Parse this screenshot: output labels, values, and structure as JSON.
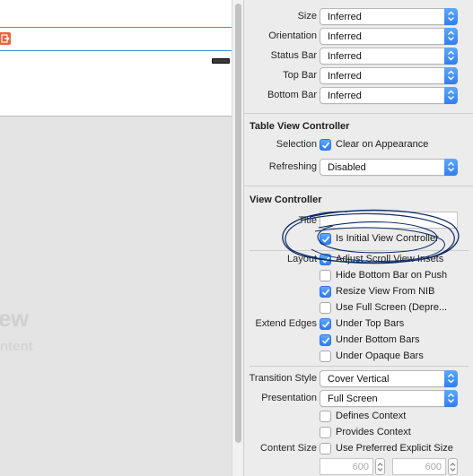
{
  "canvas": {
    "ghost_title": "ew",
    "ghost_subtitle": "ntent"
  },
  "simulated_metrics": [
    {
      "label": "Size",
      "value": "Inferred"
    },
    {
      "label": "Orientation",
      "value": "Inferred"
    },
    {
      "label": "Status Bar",
      "value": "Inferred"
    },
    {
      "label": "Top Bar",
      "value": "Inferred"
    },
    {
      "label": "Bottom Bar",
      "value": "Inferred"
    }
  ],
  "table_view_controller": {
    "title": "Table View Controller",
    "selection_label": "Selection",
    "selection_checkbox": "Clear on Appearance",
    "refreshing_label": "Refreshing",
    "refreshing_value": "Disabled"
  },
  "view_controller": {
    "title": "View Controller",
    "title_label": "Title",
    "title_value": "",
    "initial_vc": "Is Initial View Controller",
    "layout_label": "Layout",
    "layout_options": [
      {
        "label": "Adjust Scroll View Insets",
        "checked": true
      },
      {
        "label": "Hide Bottom Bar on Push",
        "checked": false
      },
      {
        "label": "Resize View From NIB",
        "checked": true
      },
      {
        "label": "Use Full Screen (Depre...",
        "checked": false
      }
    ],
    "extend_edges_label": "Extend Edges",
    "extend_edges_options": [
      {
        "label": "Under Top Bars",
        "checked": true
      },
      {
        "label": "Under Bottom Bars",
        "checked": true
      },
      {
        "label": "Under Opaque Bars",
        "checked": false
      }
    ],
    "transition_style_label": "Transition Style",
    "transition_style_value": "Cover Vertical",
    "presentation_label": "Presentation",
    "presentation_value": "Full Screen",
    "defines_context": "Defines Context",
    "provides_context": "Provides Context",
    "content_size_label": "Content Size",
    "content_size_checkbox": "Use Preferred Explicit Size",
    "width_value": "600",
    "height_value": "600"
  },
  "colors": {
    "accent": "#2f7ef3",
    "exit_icon": "#e8633a",
    "annotation_ink": "#0d2a66"
  }
}
